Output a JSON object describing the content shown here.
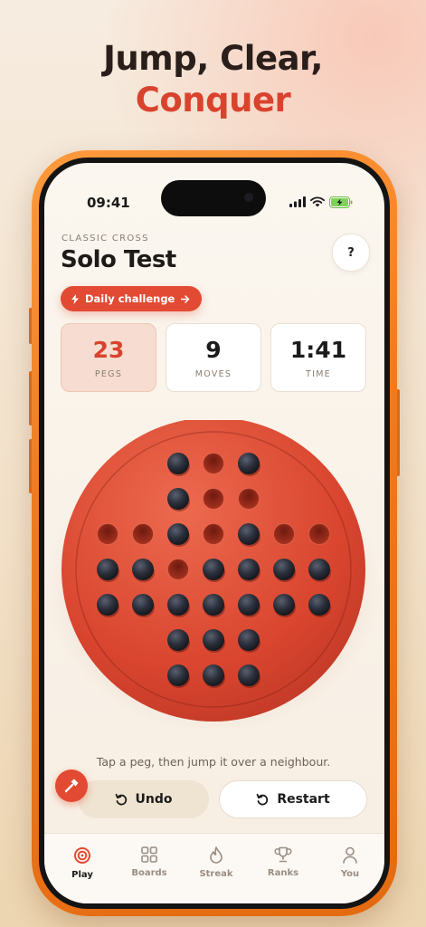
{
  "hero": {
    "line1": "Jump, Clear,",
    "line2": "Conquer"
  },
  "status_bar": {
    "time": "09:41"
  },
  "header": {
    "eyebrow": "CLASSIC CROSS",
    "title": "Solo Test",
    "help_label": "?"
  },
  "challenge": {
    "label": "Daily challenge"
  },
  "stats": [
    {
      "value": "23",
      "label": "PEGS"
    },
    {
      "value": "9",
      "label": "MOVES"
    },
    {
      "value": "1:41",
      "label": "TIME"
    }
  ],
  "board": {
    "rows": [
      "  PHP  ",
      "  PHH  ",
      "HHPHPHH",
      "PPHPPPP",
      "PPPPPPP",
      "  PPP  ",
      "  PPP  "
    ],
    "legend": {
      "P": "peg",
      "H": "empty hole"
    }
  },
  "hint": "Tap a peg, then jump it over a neighbour.",
  "actions": {
    "undo": "Undo",
    "restart": "Restart"
  },
  "tabs": [
    {
      "label": "Play",
      "icon": "target-icon",
      "active": true
    },
    {
      "label": "Boards",
      "icon": "grid-icon",
      "active": false
    },
    {
      "label": "Streak",
      "icon": "flame-icon",
      "active": false
    },
    {
      "label": "Ranks",
      "icon": "trophy-icon",
      "active": false
    },
    {
      "label": "You",
      "icon": "user-icon",
      "active": false
    }
  ],
  "colors": {
    "accent": "#e24a33",
    "board": "#de4a33",
    "peg": "#2b2f3a"
  }
}
